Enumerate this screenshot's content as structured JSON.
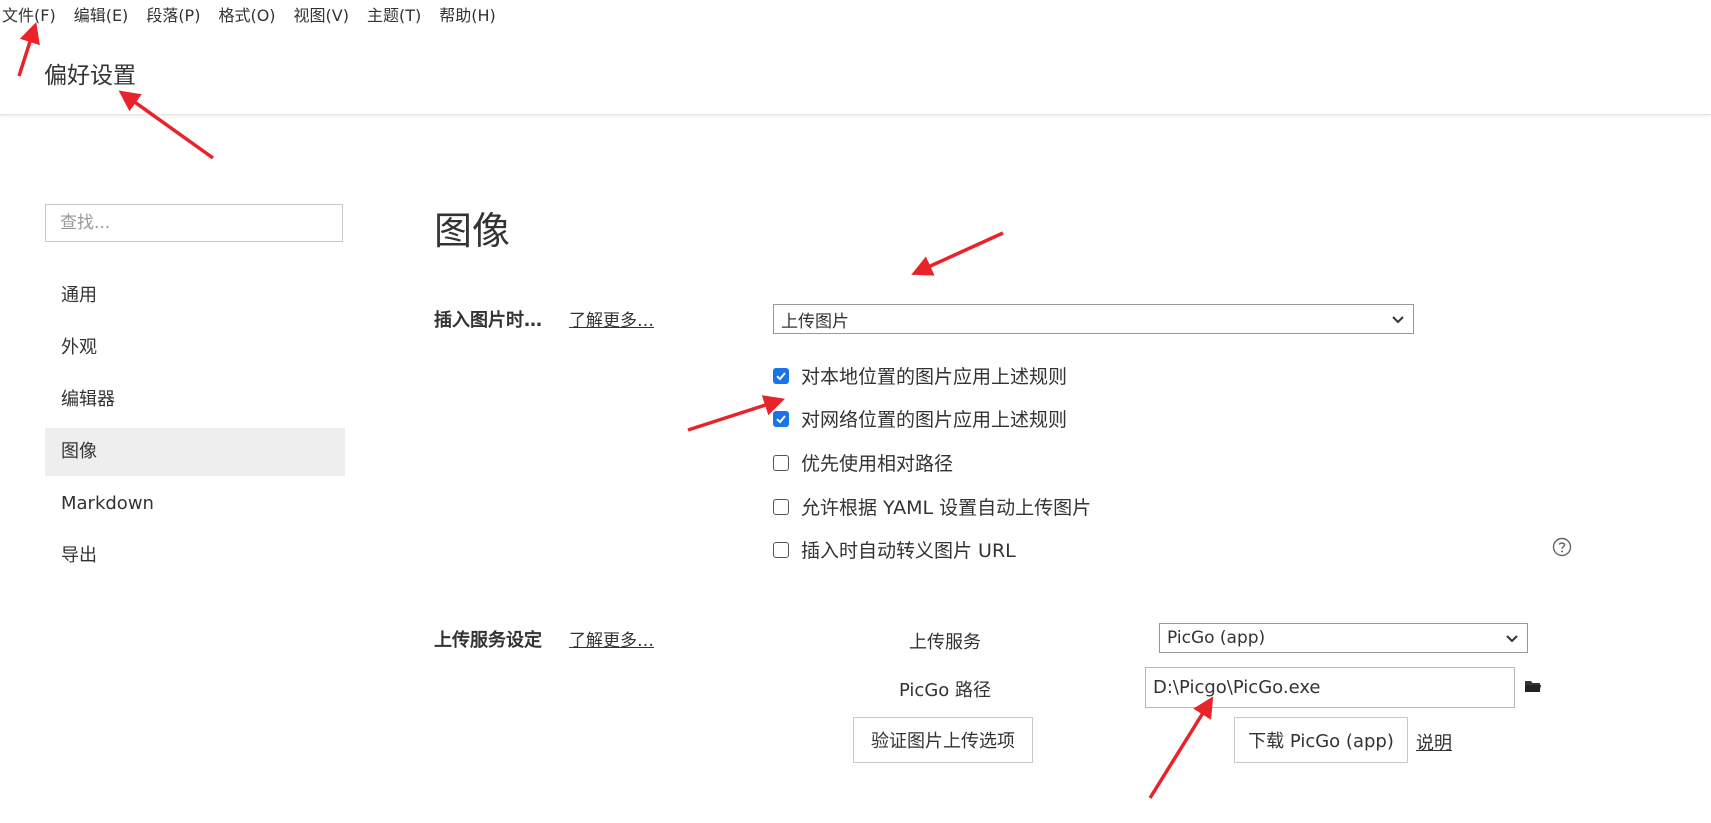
{
  "menubar": {
    "items": [
      "文件(F)",
      "编辑(E)",
      "段落(P)",
      "格式(O)",
      "视图(V)",
      "主题(T)",
      "帮助(H)"
    ]
  },
  "header": {
    "title": "偏好设置"
  },
  "search": {
    "placeholder": "查找..."
  },
  "sidebar": {
    "items": [
      {
        "label": "通用"
      },
      {
        "label": "外观"
      },
      {
        "label": "编辑器"
      },
      {
        "label": "图像",
        "active": true
      },
      {
        "label": "Markdown"
      },
      {
        "label": "导出"
      }
    ]
  },
  "main": {
    "title": "图像",
    "insert": {
      "label": "插入图片时…",
      "more": "了解更多…",
      "selected": "上传图片",
      "options": [
        {
          "label": "对本地位置的图片应用上述规则",
          "checked": true
        },
        {
          "label": "对网络位置的图片应用上述规则",
          "checked": true
        },
        {
          "label": "优先使用相对路径",
          "checked": false
        },
        {
          "label": "允许根据 YAML 设置自动上传图片",
          "checked": false
        },
        {
          "label": "插入时自动转义图片 URL",
          "checked": false
        }
      ]
    },
    "upload": {
      "label": "上传服务设定",
      "more": "了解更多…",
      "service_label": "上传服务",
      "service_value": "PicGo (app)",
      "path_label": "PicGo 路径",
      "path_value": "D:\\Picgo\\PicGo.exe",
      "verify_button": "验证图片上传选项",
      "download_button": "下载 PicGo (app)",
      "help_link": "说明"
    }
  },
  "colors": {
    "accent": "#1a73e8",
    "annotation": "#e8232a",
    "active_bg": "#eeeeee"
  }
}
